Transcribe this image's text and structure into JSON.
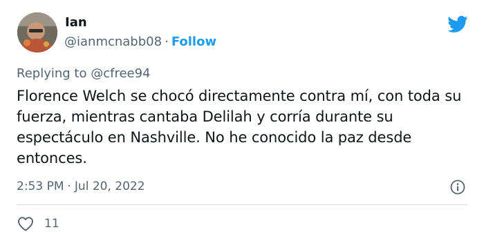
{
  "author": {
    "display_name": "Ian",
    "handle": "@ianmcnabb08",
    "separator": "·",
    "follow_label": "Follow"
  },
  "reply": {
    "prefix": "Replying to",
    "target": "@cfree94"
  },
  "tweet": {
    "text": "Florence Welch se chocó directamente contra mí, con toda su fuerza, mientras cantaba Delilah y corría durante su espectáculo en Nashville. No he conocido la paz desde entonces.",
    "time": "2:53 PM",
    "separator": "·",
    "date": "Jul 20, 2022"
  },
  "engagement": {
    "likes": "11"
  },
  "icons": {
    "logo": "twitter-bird-icon",
    "info": "info-circle-icon",
    "like": "heart-outline-icon"
  },
  "colors": {
    "accent": "#1d9bf0",
    "primary_text": "#0f1419",
    "secondary_text": "#536471",
    "divider": "#cfd9de"
  }
}
